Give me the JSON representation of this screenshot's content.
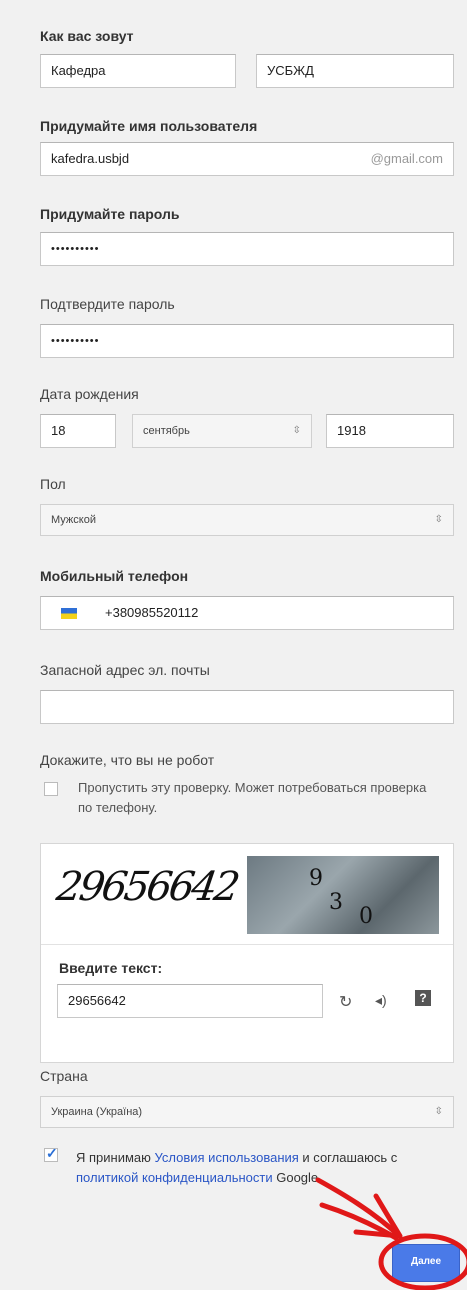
{
  "name": {
    "label": "Как вас зовут",
    "first_value": "Кафедра",
    "last_value": "УСБЖД"
  },
  "username": {
    "label": "Придумайте имя пользователя",
    "value": "kafedra.usbjd",
    "suffix": "@gmail.com"
  },
  "password": {
    "label": "Придумайте пароль",
    "value": "••••••••••"
  },
  "confirm_password": {
    "label": "Подтвердите пароль",
    "value": "••••••••••"
  },
  "birthdate": {
    "label": "Дата рождения",
    "day": "18",
    "month": "сентябрь",
    "year": "1918"
  },
  "gender": {
    "label": "Пол",
    "value": "Мужской"
  },
  "phone": {
    "label": "Мобильный телефон",
    "value": "+380985520112"
  },
  "backup_email": {
    "label": "Запасной адрес эл. почты",
    "value": ""
  },
  "robot": {
    "label": "Докажите, что вы не робот",
    "skip_text": "Пропустить эту проверку. Может потребоваться проверка по телефону.",
    "captcha_text": "29656642",
    "photo_digits": [
      "9",
      "3",
      "0"
    ],
    "enter_label": "Введите текст:",
    "enter_value": "29656642",
    "refresh_icon": "refresh-icon",
    "audio_icon": "audio-icon",
    "help_icon": "help-icon"
  },
  "country": {
    "label": "Страна",
    "value": "Украина (Україна)"
  },
  "terms": {
    "prefix": "Я принимаю ",
    "terms_link": "Условия использования",
    "middle": " и соглашаюсь с ",
    "privacy_link": "политикой конфиденциальности",
    "suffix": " Google."
  },
  "next_button": "Далее",
  "colors": {
    "accent": "#4a7ae8",
    "link": "#2a56c6",
    "annotation": "#e01818"
  }
}
